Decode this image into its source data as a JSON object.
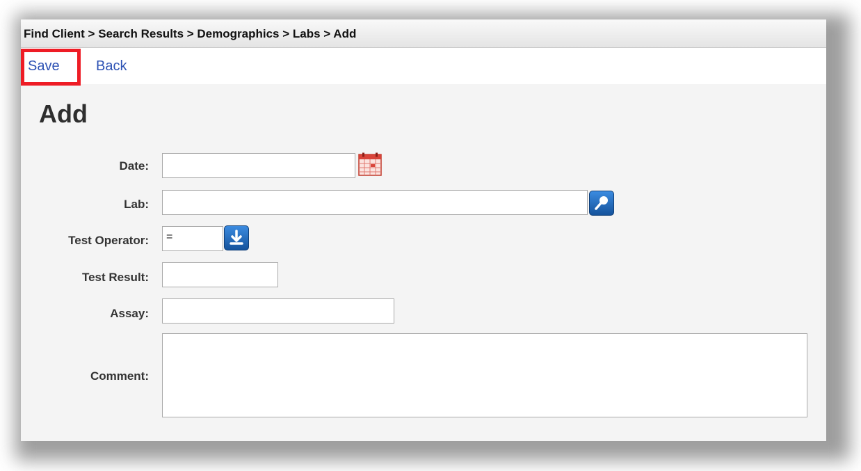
{
  "breadcrumb": "Find Client > Search Results > Demographics > Labs > Add",
  "toolbar": {
    "save_label": "Save",
    "back_label": "Back"
  },
  "page_title": "Add",
  "form": {
    "date_label": "Date:",
    "date_value": "",
    "lab_label": "Lab:",
    "lab_value": "",
    "test_operator_label": "Test Operator:",
    "test_operator_value": "=",
    "test_result_label": "Test Result:",
    "test_result_value": "",
    "assay_label": "Assay:",
    "assay_value": "",
    "comment_label": "Comment:",
    "comment_value": ""
  },
  "icons": {
    "date": "calendar-icon",
    "lab": "magnifier-search-icon",
    "operator": "download-arrow-icon"
  },
  "colors": {
    "link": "#2d52b4",
    "highlight": "#ee1c25",
    "icon_button": "#1f6cc0"
  }
}
